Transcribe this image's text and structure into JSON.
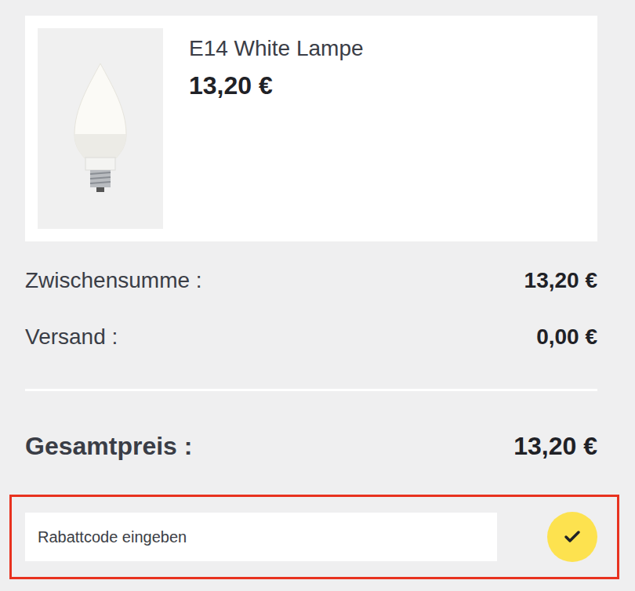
{
  "product": {
    "name": "E14 White Lampe",
    "price": "13,20 €"
  },
  "summary": [
    {
      "label": "Zwischensumme :",
      "value": "13,20 €"
    },
    {
      "label": "Versand :",
      "value": "0,00 €"
    }
  ],
  "total": {
    "label": "Gesamtpreis :",
    "value": "13,20 €"
  },
  "discount": {
    "placeholder": "Rabattcode eingeben"
  }
}
